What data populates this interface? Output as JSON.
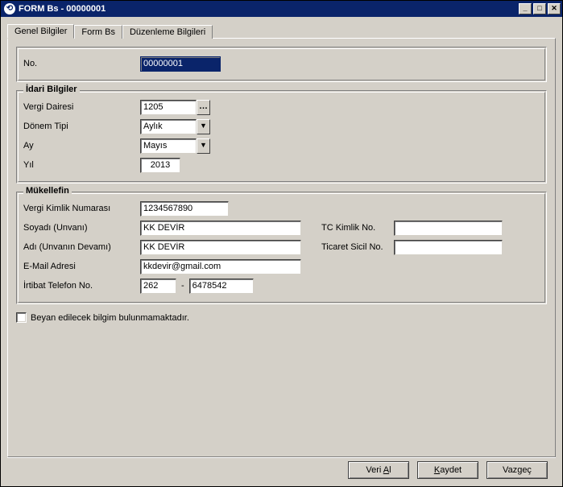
{
  "window": {
    "title": "FORM Bs - 00000001"
  },
  "tabs": {
    "t0": "Genel Bilgiler",
    "t1": "Form Bs",
    "t2": "Düzenleme Bilgileri"
  },
  "labels": {
    "no": "No.",
    "idari": "İdari Bilgiler",
    "vergi_dairesi": "Vergi Dairesi",
    "donem_tipi": "Dönem Tipi",
    "ay": "Ay",
    "yil": "Yıl",
    "mukellefin": "Mükellefin",
    "vkn": "Vergi Kimlik Numarası",
    "soyadi": "Soyadı (Unvanı)",
    "adi": "Adı (Unvanın Devamı)",
    "email": "E-Mail Adresi",
    "telefon": "İrtibat Telefon No.",
    "tc": "TC Kimlik No.",
    "sicil": "Ticaret Sicil No.",
    "beyan": "Beyan edilecek bilgim bulunmamaktadır.",
    "dash": "-"
  },
  "values": {
    "no": "00000001",
    "vergi_dairesi": "1205",
    "donem_tipi": "Aylık",
    "ay": "Mayıs",
    "yil": "2013",
    "vkn": "1234567890",
    "soyadi": "KK DEVİR",
    "adi": "KK DEVİR",
    "email": "kkdevir@gmail.com",
    "tel_area": "262",
    "tel_num": "6478542",
    "tc": "",
    "sicil": ""
  },
  "buttons": {
    "veri_al_pre": "Veri ",
    "veri_al_u": "A",
    "veri_al_post": "l",
    "kaydet_u": "K",
    "kaydet_post": "aydet",
    "vazgec_pre": "Vaz",
    "vazgec_u": "g",
    "vazgec_post": "eç"
  },
  "winbtns": {
    "min": "_",
    "max": "□",
    "close": "✕"
  }
}
